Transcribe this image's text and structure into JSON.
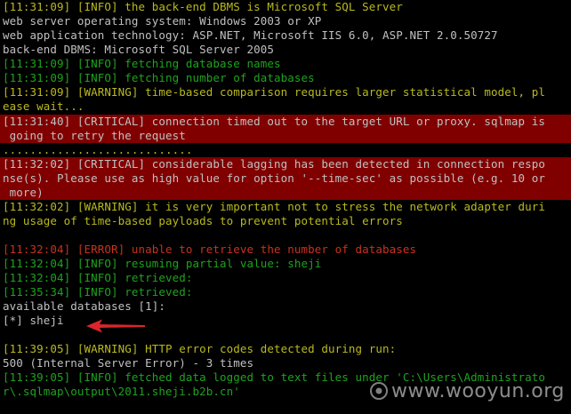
{
  "terminal": {
    "lines": [
      "[11:31:09] [INFO] the back-end DBMS is Microsoft SQL Server",
      "web server operating system: Windows 2003 or XP",
      "web application technology: ASP.NET, Microsoft IIS 6.0, ASP.NET 2.0.50727",
      "back-end DBMS: Microsoft SQL Server 2005",
      "[11:31:09] [INFO] fetching database names",
      "[11:31:09] [INFO] fetching number of databases",
      "[11:31:09] [WARNING] time-based comparison requires larger statistical model, pl",
      "ease wait...",
      "[11:31:40] [CRITICAL] connection timed out to the target URL or proxy. sqlmap is",
      " going to retry the request",
      "............................",
      "[11:32:02] [CRITICAL] considerable lagging has been detected in connection respo",
      "nse(s). Please use as high value for option '--time-sec' as possible (e.g. 10 or",
      " more)",
      "[11:32:02] [WARNING] it is very important not to stress the network adapter duri",
      "ng usage of time-based payloads to prevent potential errors",
      "",
      "[11:32:04] [ERROR] unable to retrieve the number of databases",
      "[11:32:04] [INFO] resuming partial value: sheji",
      "[11:32:04] [INFO] retrieved:",
      "[11:35:34] [INFO] retrieved:",
      "available databases [1]:",
      "[*] sheji",
      "",
      "[11:39:05] [WARNING] HTTP error codes detected during run:",
      "500 (Internal Server Error) - 3 times",
      "[11:39:05] [INFO] fetched data logged to text files under 'C:\\Users\\Administrato",
      "r\\.sqlmap\\output\\2011.sheji.b2b.cn'"
    ],
    "watermark": "www.wooyun.org",
    "colors": {
      "background": "#000000",
      "default_text": "#c0c0c0",
      "info": "#1fa21f",
      "warning": "#b9b91f",
      "error": "#c8321e",
      "critical_bg": "#800000",
      "arrow": "#d8262c"
    }
  }
}
